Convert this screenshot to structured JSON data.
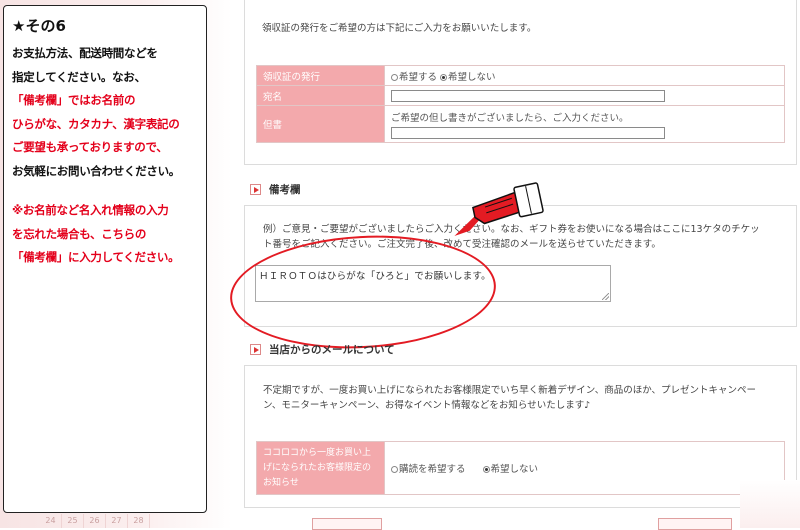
{
  "notice": {
    "title": "★その6",
    "lines": [
      {
        "text": "お支払方法、配送時間などを",
        "color": "#111111"
      },
      {
        "text": "指定してください。なお、",
        "color": "#111111"
      },
      {
        "text": "「備考欄」ではお名前の",
        "color": "#e4001b"
      },
      {
        "text": "ひらがな、カタカナ、漢字表記の",
        "color": "#e4001b"
      },
      {
        "text": "ご要望も承っておりますので、",
        "color": "#e4001b"
      },
      {
        "text": "お気軽にお問い合わせください。",
        "color": "#111111"
      },
      {
        "text": "※お名前など名入れ情報の入力",
        "color": "#e4001b"
      },
      {
        "text": "を忘れた場合も、こちらの",
        "color": "#e4001b"
      },
      {
        "text": "「備考欄」に入力してください。",
        "color": "#e4001b"
      }
    ]
  },
  "calendar_strip": [
    "24",
    "25",
    "26",
    "27",
    "28"
  ],
  "receipt": {
    "intro": "領収証の発行をご希望の方は下記にご入力をお願いいたします。",
    "rows": {
      "issue_label": "領収証の発行",
      "issue_options": [
        "希望する",
        "希望しない"
      ],
      "issue_selected": "希望しない",
      "name_label": "宛名",
      "note_label": "但書",
      "note_hint": "ご希望の但し書きがございましたら、ご入力ください。"
    }
  },
  "remarks": {
    "heading": "備考欄",
    "example_line1": "例）ご意見・ご要望がございましたらご入力ください。なお、ギフト券をお使いになる場合はここに13ケタのチケッ",
    "example_line2": "ト番号をご記入ください。ご注文完了後、改めて受注確認のメールを送らせていただきます。",
    "textarea_value": "ＨＩＲＯＴＯはひらがな「ひろと」でお願いします。"
  },
  "mail": {
    "heading": "当店からのメールについて",
    "desc_line1": "不定期ですが、一度お買い上げになられたお客様限定でいち早く新着デザイン、商品のほか、プレゼントキャンペー",
    "desc_line2": "ン、モニターキャンペーン、お得なイベント情報などをお知らせいたします♪",
    "pref_label": "ココロコから一度お買い上げになられたお客様限定のお知らせ",
    "options": [
      "購読を希望する",
      "希望しない"
    ],
    "selected": "希望しない"
  },
  "colors": {
    "accent_red": "#e31b23",
    "label_pink": "#f3a9ac"
  }
}
